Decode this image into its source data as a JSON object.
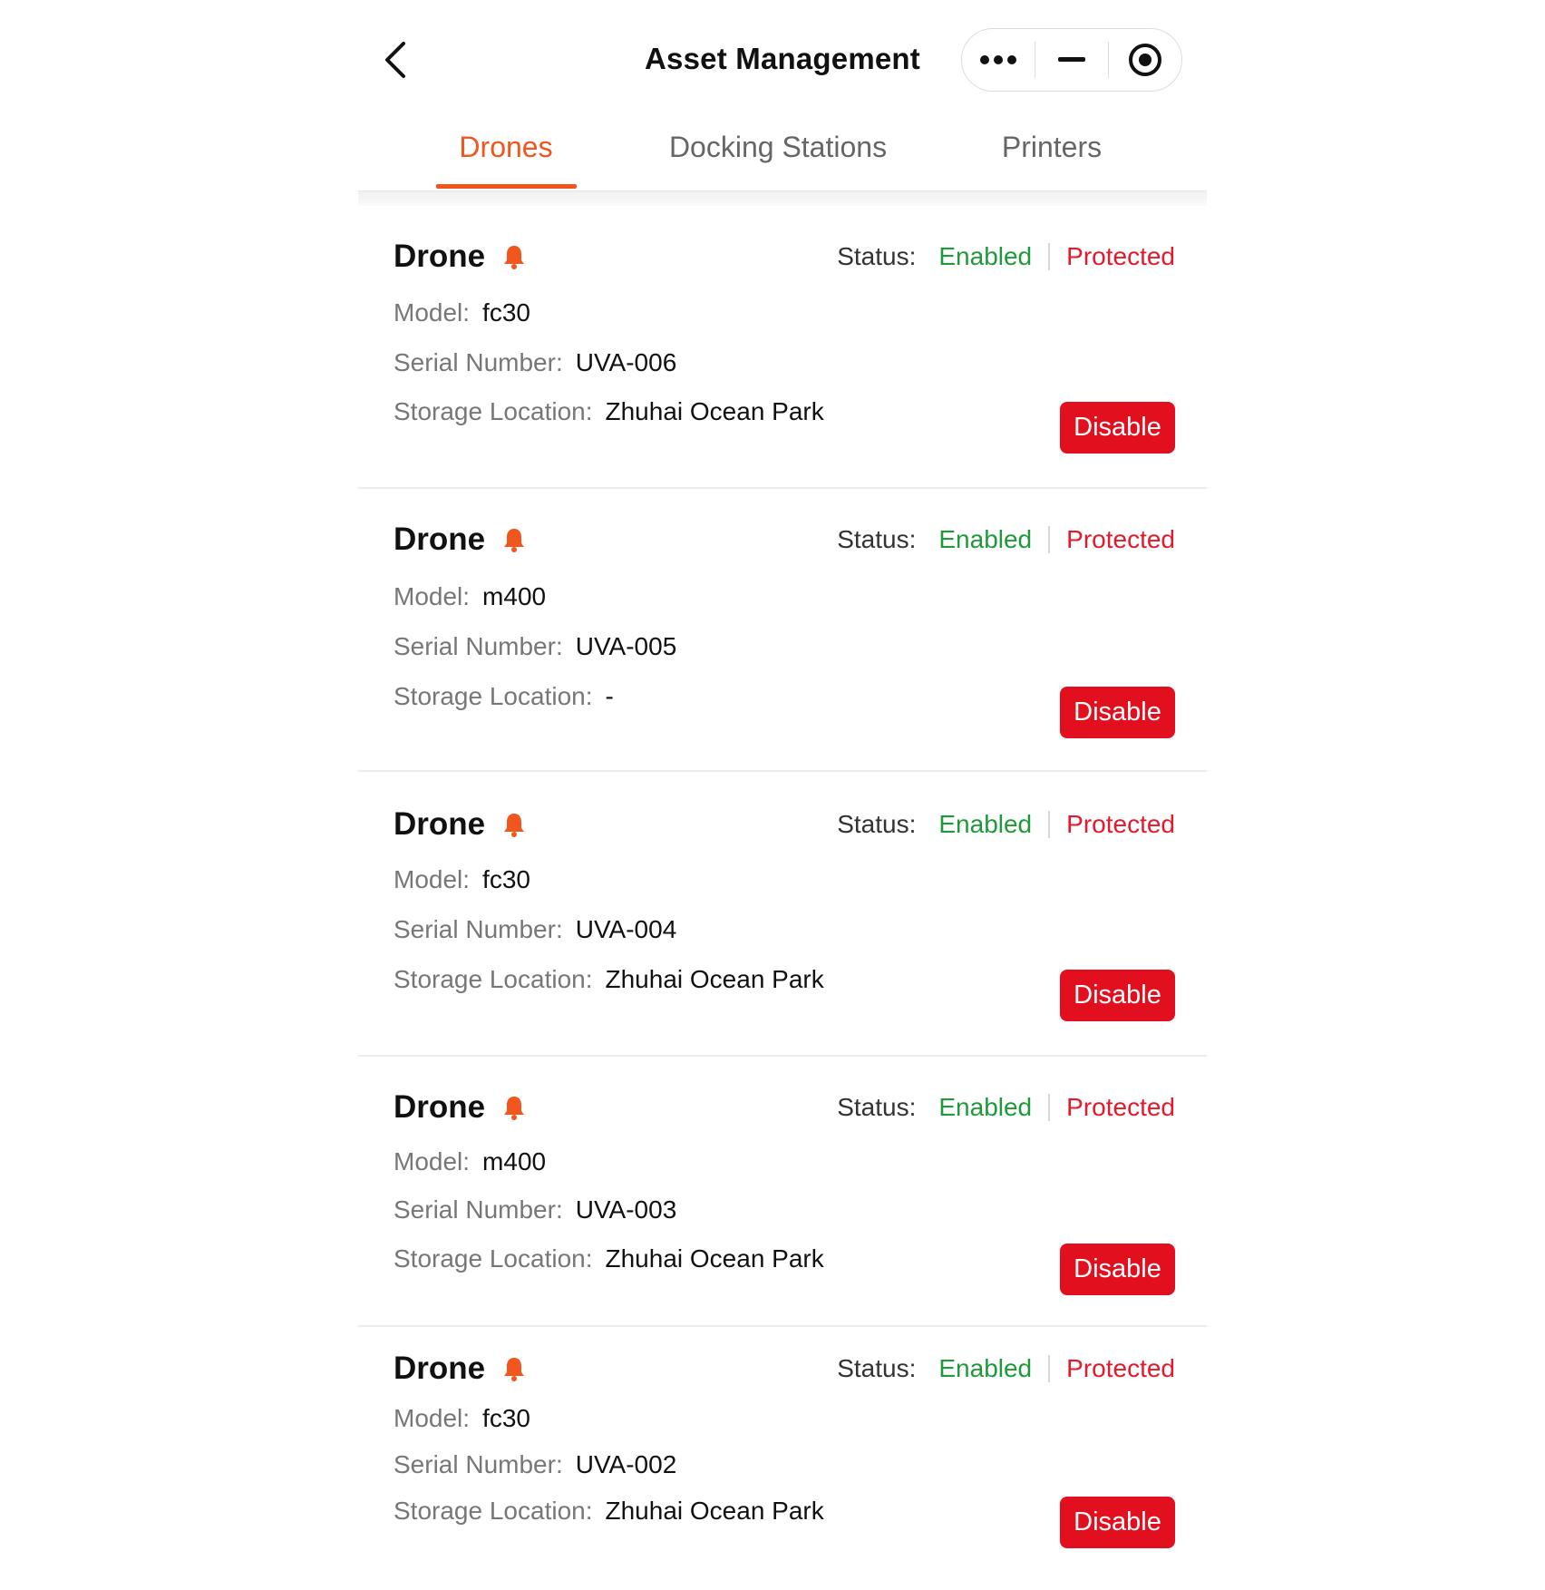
{
  "header": {
    "title": "Asset Management",
    "back_icon": "chevron-left-icon",
    "capsule": [
      "more-icon",
      "minimize-icon",
      "target-icon"
    ]
  },
  "tabs": [
    {
      "label": "Drones",
      "active": true
    },
    {
      "label": "Docking Stations",
      "active": false
    },
    {
      "label": "Printers",
      "active": false
    }
  ],
  "colors": {
    "accent": "#f0561d",
    "enabled": "#1f9a3b",
    "protected": "#e21a2c",
    "button": "#e2101f"
  },
  "labels": {
    "status": "Status:",
    "model": "Model:",
    "serial": "Serial Number:",
    "location": "Storage Location:"
  },
  "cards": [
    {
      "title": "Drone",
      "enabled": "Enabled",
      "protected": "Protected",
      "model": "fc30",
      "serial": "UVA-006",
      "location": "Zhuhai Ocean Park",
      "action": "Disable"
    },
    {
      "title": "Drone",
      "enabled": "Enabled",
      "protected": "Protected",
      "model": "m400",
      "serial": "UVA-005",
      "location": "-",
      "action": "Disable"
    },
    {
      "title": "Drone",
      "enabled": "Enabled",
      "protected": "Protected",
      "model": "fc30",
      "serial": "UVA-004",
      "location": "Zhuhai Ocean Park",
      "action": "Disable"
    },
    {
      "title": "Drone",
      "enabled": "Enabled",
      "protected": "Protected",
      "model": "m400",
      "serial": "UVA-003",
      "location": "Zhuhai Ocean Park",
      "action": "Disable"
    },
    {
      "title": "Drone",
      "enabled": "Enabled",
      "protected": "Protected",
      "model": "fc30",
      "serial": "UVA-002",
      "location": "Zhuhai Ocean Park",
      "action": "Disable"
    }
  ]
}
